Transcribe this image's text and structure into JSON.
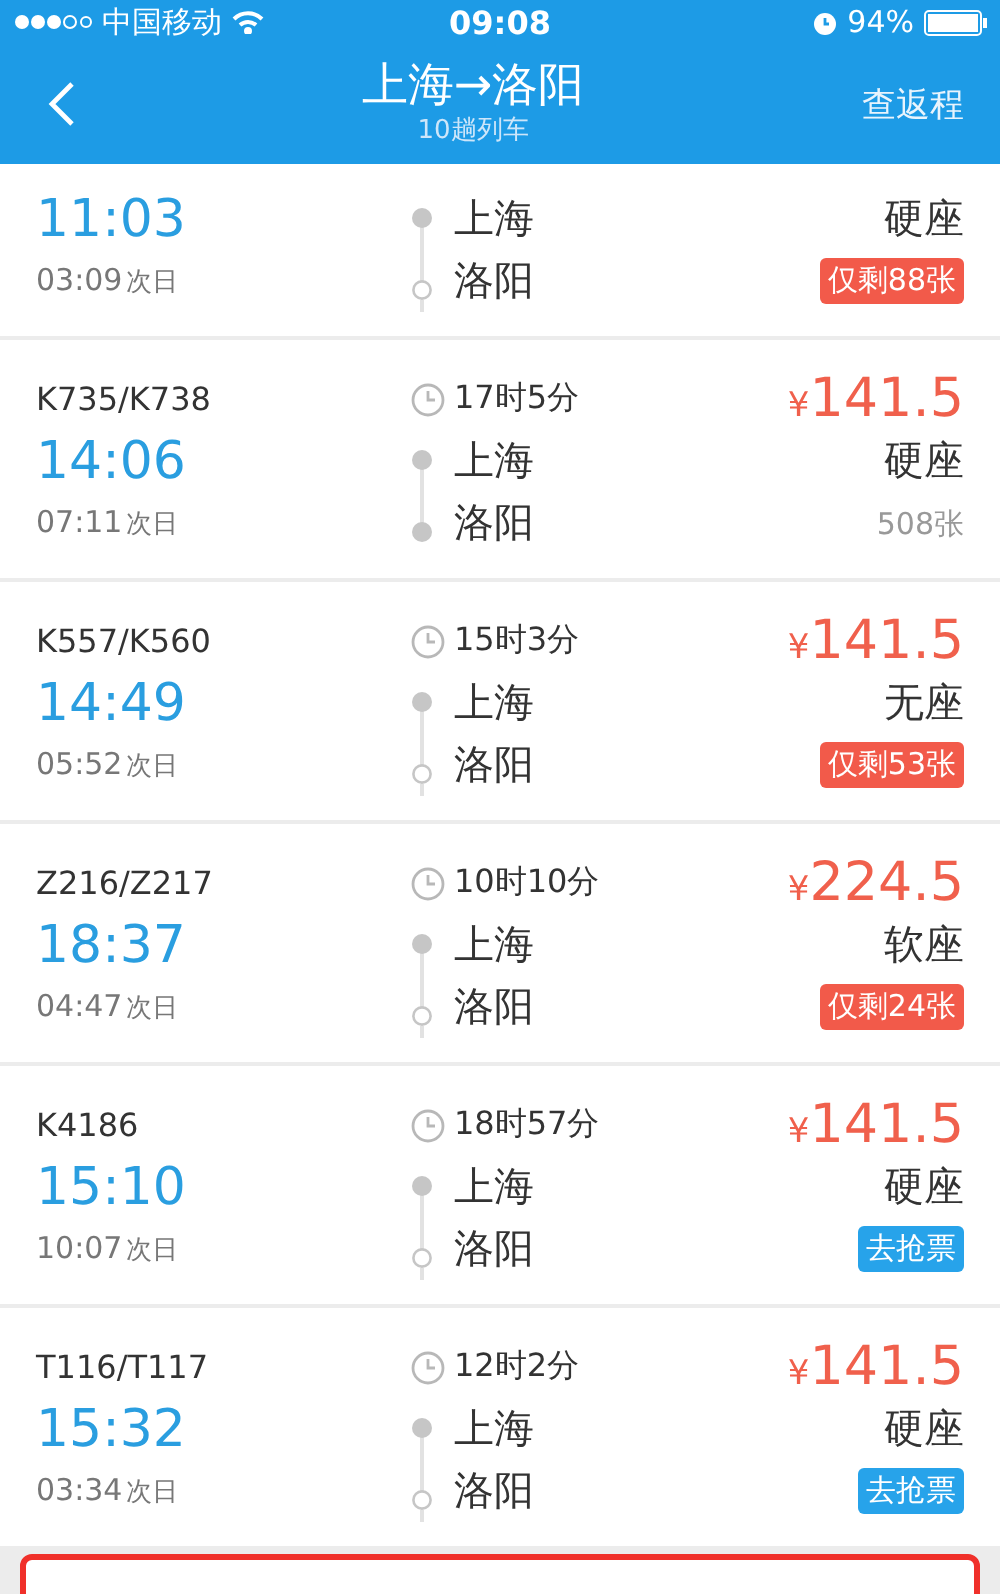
{
  "status_bar": {
    "carrier": "中国移动",
    "time": "09:08",
    "battery": "94%"
  },
  "nav": {
    "title": "上海→洛阳",
    "subtitle": "10趟列车",
    "action": "查返程"
  },
  "trains": [
    {
      "kind": "partial",
      "depart": "11:03",
      "arrive": "03:09",
      "arrive_note": "次日",
      "from": "上海",
      "to": "洛阳",
      "to_filled": false,
      "seat": "硬座",
      "tickets": {
        "kind": "few",
        "text": "仅剩88张"
      }
    },
    {
      "kind": "full",
      "number": "K735/K738",
      "duration": "17时5分",
      "currency": "¥",
      "price": "141.5",
      "depart": "14:06",
      "arrive": "07:11",
      "arrive_note": "次日",
      "from": "上海",
      "to": "洛阳",
      "to_filled": true,
      "seat": "硬座",
      "tickets": {
        "kind": "plenty",
        "text": "508张"
      }
    },
    {
      "kind": "full",
      "number": "K557/K560",
      "duration": "15时3分",
      "currency": "¥",
      "price": "141.5",
      "depart": "14:49",
      "arrive": "05:52",
      "arrive_note": "次日",
      "from": "上海",
      "to": "洛阳",
      "to_filled": false,
      "seat": "无座",
      "tickets": {
        "kind": "few",
        "text": "仅剩53张"
      }
    },
    {
      "kind": "full",
      "number": "Z216/Z217",
      "duration": "10时10分",
      "currency": "¥",
      "price": "224.5",
      "depart": "18:37",
      "arrive": "04:47",
      "arrive_note": "次日",
      "from": "上海",
      "to": "洛阳",
      "to_filled": false,
      "seat": "软座",
      "tickets": {
        "kind": "few",
        "text": "仅剩24张"
      }
    },
    {
      "kind": "full",
      "number": "K4186",
      "duration": "18时57分",
      "currency": "¥",
      "price": "141.5",
      "depart": "15:10",
      "arrive": "10:07",
      "arrive_note": "次日",
      "from": "上海",
      "to": "洛阳",
      "to_filled": false,
      "seat": "硬座",
      "tickets": {
        "kind": "grab",
        "text": "去抢票"
      }
    },
    {
      "kind": "full",
      "number": "T116/T117",
      "duration": "12时2分",
      "currency": "¥",
      "price": "141.5",
      "depart": "15:32",
      "arrive": "03:34",
      "arrive_note": "次日",
      "from": "上海",
      "to": "洛阳",
      "to_filled": false,
      "seat": "硬座",
      "tickets": {
        "kind": "grab",
        "text": "去抢票"
      }
    }
  ],
  "highlight": {
    "kind": "frame"
  }
}
